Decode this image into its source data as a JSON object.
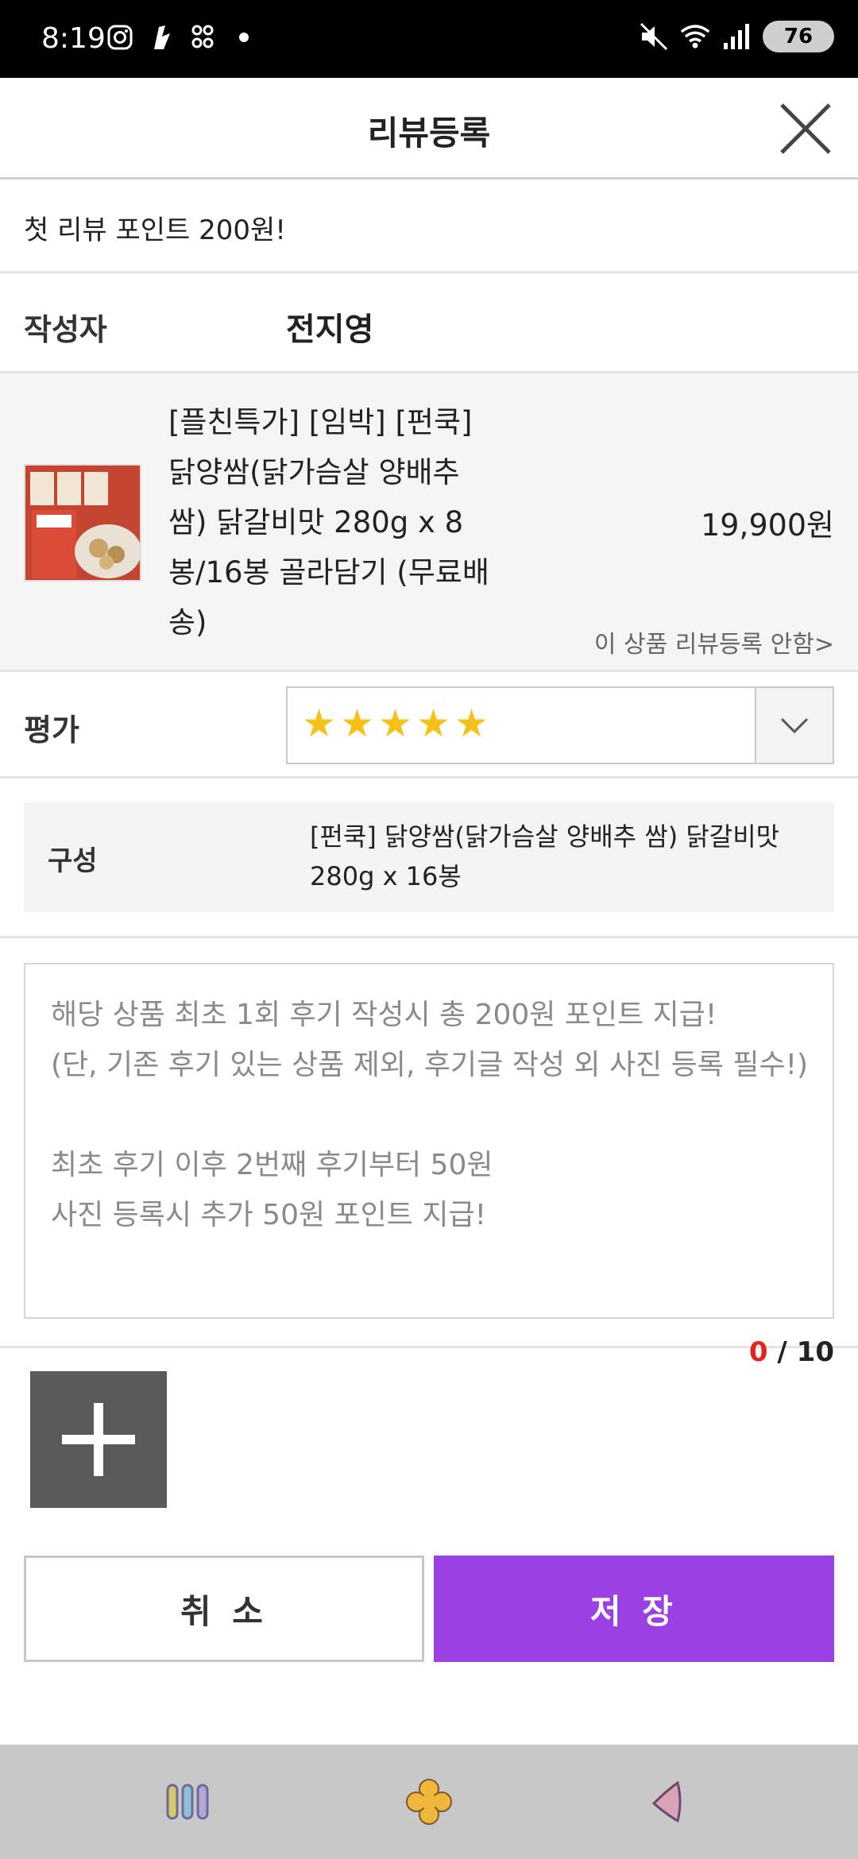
{
  "status_bar": {
    "time": "8:19",
    "battery": "76",
    "icons": [
      "instagram-icon",
      "app-icon",
      "app-grid-icon",
      "dot-icon",
      "mute-icon",
      "wifi-icon",
      "signal-icon",
      "battery-icon"
    ]
  },
  "header": {
    "title": "리뷰등록",
    "close_icon": "close-icon"
  },
  "promo": {
    "text": "첫 리뷰 포인트 200원!"
  },
  "author": {
    "label": "작성자",
    "name": "전지영"
  },
  "product": {
    "name": "[플친특가] [임박] [펀쿡] 닭양쌈(닭가슴살 양배추 쌈) 닭갈비맛 280g x 8봉/16봉 골라담기 (무료배송)",
    "price": "19,900원",
    "guide_link": "이 상품 리뷰등록 안함>",
    "thumb_text": "닭양쌈"
  },
  "rating": {
    "label": "평가",
    "value": 5,
    "max": 5
  },
  "option": {
    "label": "구성",
    "value": "[펀쿡] 닭양쌈(닭가슴살 양배추 쌈) 닭갈비맛 280g x 16봉"
  },
  "review": {
    "placeholder": "해당 상품 최초 1회 후기 작성시 총 200원 포인트 지급!\n(단, 기존 후기 있는 상품 제외, 후기글 작성 외 사진 등록 필수!)\n\n최초 후기 이후 2번째 후기부터 50원\n사진 등록시 추가 50원 포인트 지급!"
  },
  "photo_counter": {
    "current": "0",
    "separator": " / ",
    "max": "10"
  },
  "buttons": {
    "cancel": "취 소",
    "save": "저 장"
  },
  "colors": {
    "accent": "#9b41e4",
    "star": "#f6c118",
    "counter_current": "#e8211b"
  }
}
